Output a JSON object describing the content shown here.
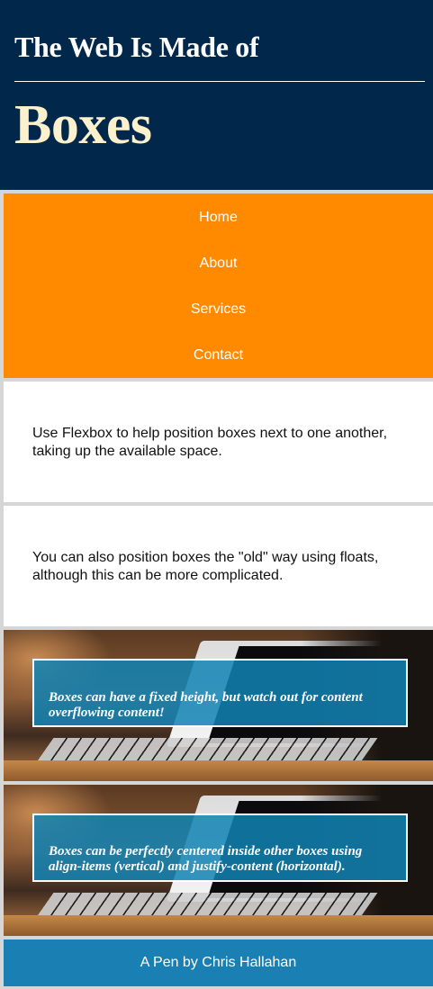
{
  "header": {
    "pre_title": "The Web Is Made of",
    "title": "Boxes"
  },
  "nav": {
    "items": [
      {
        "label": "Home"
      },
      {
        "label": "About"
      },
      {
        "label": "Services"
      },
      {
        "label": "Contact"
      }
    ]
  },
  "panels": [
    {
      "text": "Use Flexbox to help position boxes next to one another, taking up the available space."
    },
    {
      "text": "You can also position boxes the \"old\" way using floats, although this can be more complicated."
    }
  ],
  "image_boxes": [
    {
      "text": "Boxes can have a fixed height, but watch out for content overflowing content!"
    },
    {
      "text": "Boxes can be perfectly centered inside other boxes using align-items (vertical) and justify-content (horizontal)."
    }
  ],
  "footer": {
    "text": "A Pen by Chris Hallahan"
  },
  "colors": {
    "header_bg": "#01284a",
    "title_accent": "#fdf1cd",
    "nav_bg": "#ff8a00",
    "caption_bg": "#1082b4",
    "footer_bg": "#1a80b3",
    "page_bg": "#d6d6d6"
  }
}
